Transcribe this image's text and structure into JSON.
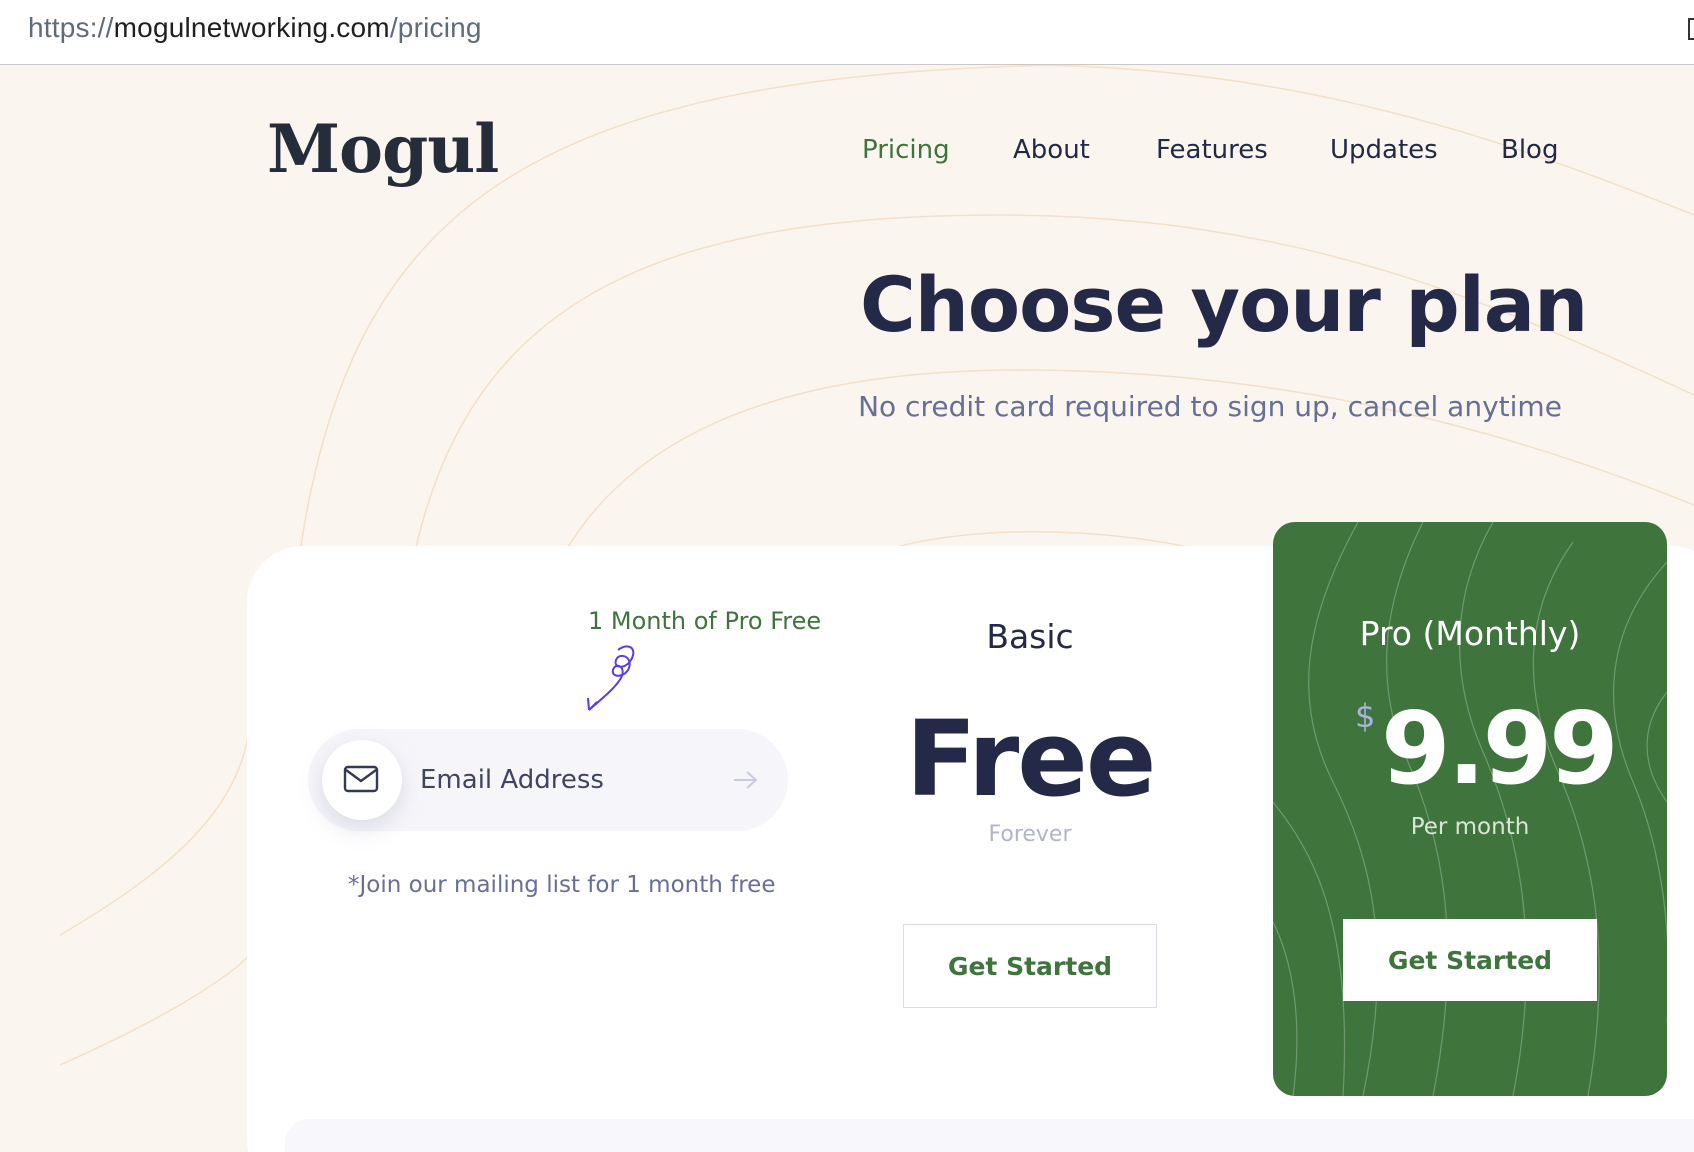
{
  "browser": {
    "url_protocol": "https://",
    "url_domain": "mogulnetworking.com",
    "url_path": "/pricing"
  },
  "header": {
    "logo": "Mogul",
    "nav": [
      "Pricing",
      "About",
      "Features",
      "Updates",
      "Blog"
    ],
    "active_nav": "Pricing"
  },
  "hero": {
    "title": "Choose your plan",
    "subtitle": "No credit card required to sign up, cancel anytime"
  },
  "signup": {
    "promo_label": "1 Month of Pro Free",
    "email_placeholder": "Email Address",
    "note": "*Join our mailing list for 1 month free"
  },
  "plans": {
    "basic": {
      "name": "Basic",
      "price": "Free",
      "period": "Forever",
      "cta": "Get Started"
    },
    "pro": {
      "name": "Pro (Monthly)",
      "currency": "$",
      "price": "9.99",
      "period": "Per month",
      "cta": "Get Started"
    }
  },
  "colors": {
    "page_background": "#fbf5f0",
    "brand_green": "#3f743d",
    "heading_navy": "#232946",
    "muted_text": "#676f95"
  }
}
